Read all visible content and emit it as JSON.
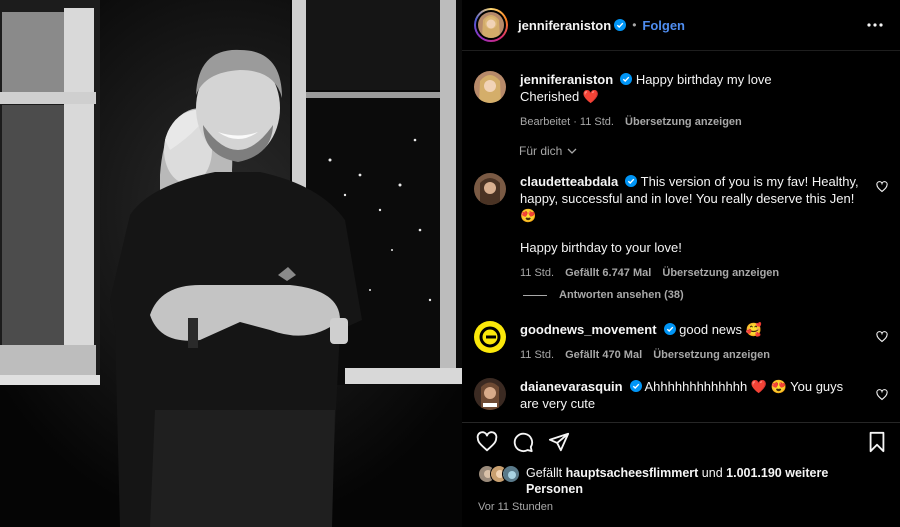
{
  "post_author": {
    "username": "jenniferaniston",
    "separator": "•",
    "follow_label": "Folgen"
  },
  "caption": {
    "username": "jenniferaniston",
    "text_line1": "Happy birthday my love",
    "text_line2": "Cherished ❤️",
    "edited": "Bearbeitet · 11 Std.",
    "translate": "Übersetzung anzeigen"
  },
  "sort_label": "Für dich",
  "comments": [
    {
      "username": "claudetteabdala",
      "text": "This version of you is my fav! Healthy, happy, successful and in love! You really deserve this Jen! 😍",
      "text_extra": "Happy birthday to your love!",
      "time": "11 Std.",
      "likes": "Gefällt 6.747 Mal",
      "translate": "Übersetzung anzeigen",
      "replies": "Antworten ansehen (38)"
    },
    {
      "username": "goodnews_movement",
      "text": "good news 🥰",
      "time": "11 Std.",
      "likes": "Gefällt 470 Mal",
      "translate": "Übersetzung anzeigen"
    },
    {
      "username": "daianevarasquin",
      "text": "Ahhhhhhhhhhhhh ❤️ 😍 You guys are very cute"
    }
  ],
  "likes_summary": {
    "prefix": "Gefällt",
    "user": "hauptsacheesflimmert",
    "connector": "und",
    "others": "1.001.190 weitere Personen"
  },
  "timestamp": "Vor 11 Stunden",
  "colors": {
    "accent_blue": "#4f8df0",
    "verified_blue": "#0095f6",
    "heart_red": "#ed4956",
    "muted_text": "#a8a8a8"
  },
  "icons": [
    "more-options-icon",
    "verified-icon",
    "chevron-down-icon",
    "heart-icon",
    "comment-icon",
    "share-icon",
    "bookmark-icon"
  ]
}
